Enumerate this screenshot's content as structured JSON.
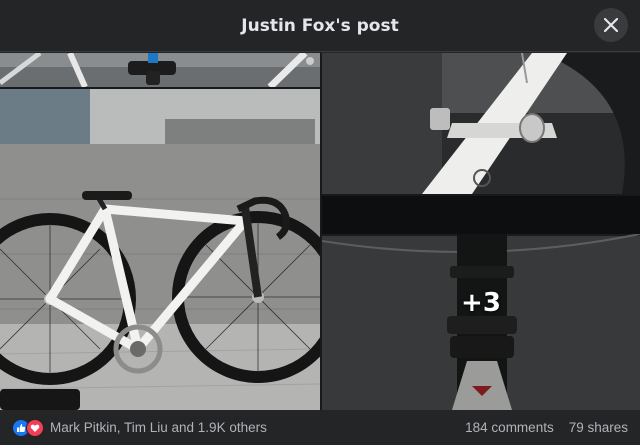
{
  "header": {
    "title": "Justin Fox's post"
  },
  "photos": {
    "more_count": "+3"
  },
  "footer": {
    "reactions_text": "Mark Pitkin, Tim Liu and 1.9K others",
    "comments": "184 comments",
    "shares": "79 shares"
  },
  "icons": {
    "close": "close-icon",
    "like": "like-reaction-icon",
    "love": "love-reaction-icon"
  },
  "colors": {
    "like": "#1877f2",
    "love": "#f33e58",
    "background": "#242526"
  }
}
